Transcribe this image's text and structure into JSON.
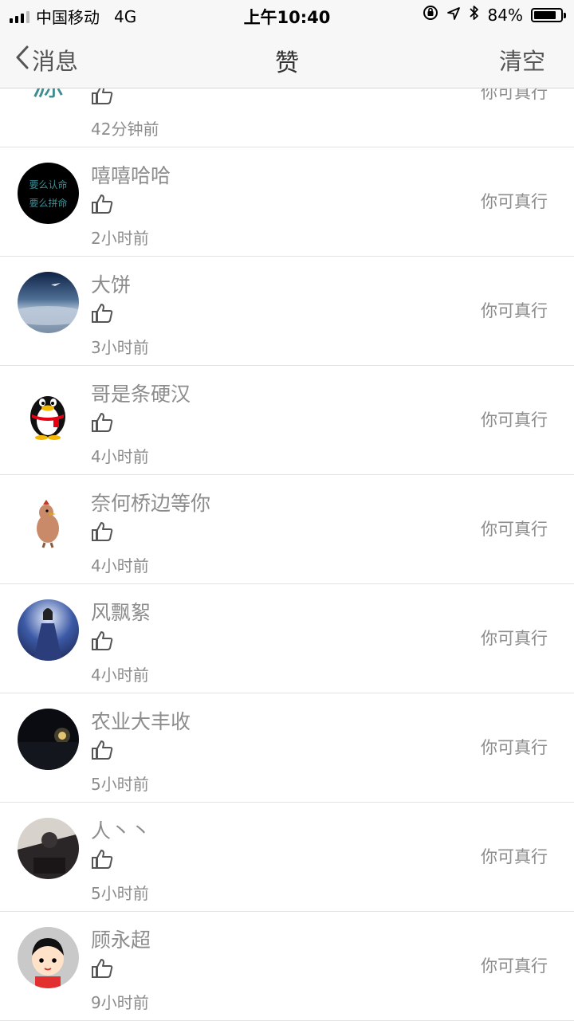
{
  "status_bar": {
    "carrier": "中国移动",
    "network": "4G",
    "time": "上午10:40",
    "battery": "84%",
    "battery_level": 0.84
  },
  "nav": {
    "back_label": "消息",
    "title": "赞",
    "clear_label": "清空"
  },
  "items": [
    {
      "name": "",
      "time": "42分钟前",
      "content": "你可真行",
      "avatar": "teal-text-avatar"
    },
    {
      "name": "嘻嘻哈哈",
      "time": "2小时前",
      "content": "你可真行",
      "avatar": "black-text-avatar",
      "avatar_text": [
        "要么认命",
        "要么拼命"
      ]
    },
    {
      "name": "大饼",
      "time": "3小时前",
      "content": "你可真行",
      "avatar": "sky-photo-avatar"
    },
    {
      "name": "哥是条硬汉",
      "time": "4小时前",
      "content": "你可真行",
      "avatar": "penguin-avatar"
    },
    {
      "name": "奈何桥边等你",
      "time": "4小时前",
      "content": "你可真行",
      "avatar": "chicken-avatar"
    },
    {
      "name": "风飘絮",
      "time": "4小时前",
      "content": "你可真行",
      "avatar": "portrait-photo-avatar"
    },
    {
      "name": "农业大丰收",
      "time": "5小时前",
      "content": "你可真行",
      "avatar": "night-photo-avatar"
    },
    {
      "name": "人丶丶",
      "time": "5小时前",
      "content": "你可真行",
      "avatar": "dark-photo-avatar"
    },
    {
      "name": "顾永超",
      "time": "9小时前",
      "content": "你可真行",
      "avatar": "cartoon-boy-avatar"
    }
  ]
}
